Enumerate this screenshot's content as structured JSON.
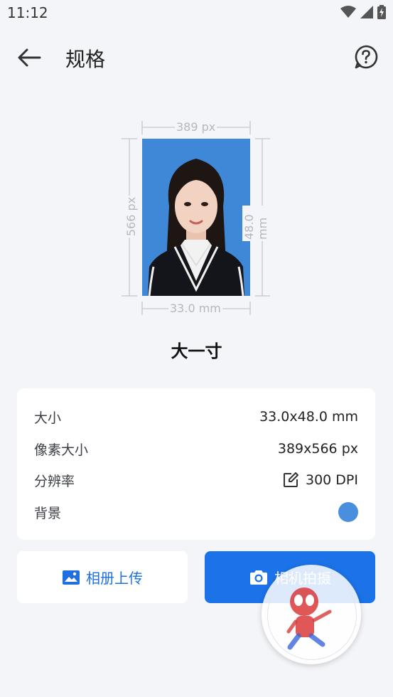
{
  "status": {
    "time": "11:12"
  },
  "header": {
    "title": "规格"
  },
  "diagram": {
    "width_px": "389 px",
    "height_px": "566 px",
    "width_mm": "33.0 mm",
    "height_mm": "48.0 mm"
  },
  "spec_name": "大一寸",
  "info": {
    "size_label": "大小",
    "size_value": "33.0x48.0 mm",
    "pixels_label": "像素大小",
    "pixels_value": "389x566 px",
    "dpi_label": "分辨率",
    "dpi_value": "300 DPI",
    "bg_label": "背景",
    "bg_color": "#4a8ee0"
  },
  "actions": {
    "album_label": "相册上传",
    "camera_label": "相机拍摄"
  }
}
